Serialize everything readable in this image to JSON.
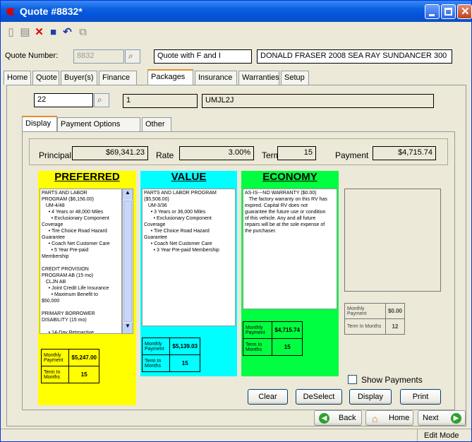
{
  "window": {
    "title": "Quote #8832*"
  },
  "header": {
    "quote_number_label": "Quote Number:",
    "quote_number_value": "8832",
    "quote_desc": "Quote with F and I",
    "unit_desc": "DONALD FRASER 2008 SEA RAY SUNDANCER 300"
  },
  "main_tabs": [
    "Home",
    "Quote",
    "Buyer(s)",
    "Finance",
    "Packages",
    "Insurance",
    "Warranties",
    "Setup"
  ],
  "packages": {
    "code": "22",
    "seq": "1",
    "plan_code": "UMJL2J"
  },
  "sub_tabs": [
    "Display",
    "Payment Options",
    "Other"
  ],
  "terms": {
    "principal_label": "Principal",
    "principal": "$69,341.23",
    "rate_label": "Rate",
    "rate": "3.00%",
    "term_label": "Term",
    "term": "15",
    "payment_label": "Payment",
    "payment": "$4,715.74"
  },
  "columns": [
    {
      "title": "PREFERRED",
      "color": "#ffff00",
      "lines": [
        "PARTS AND LABOR",
        "PROGRAM ($6,156.00)",
        "   UM-4/48",
        "     • 4 Years or 48,000 Miles",
        "       • Exclusionary Component",
        "Coverage",
        "     • Tire Choice Road Hazard",
        "Guarantee",
        "     • Coach Net Customer Care",
        "       • 5 Year Pre-paid",
        "Membership",
        "",
        "CREDIT PROVISION",
        "PROGRAM AB (15 mo)",
        "   CLJN AB",
        "     • Joint Credit Life Insurance",
        "       • Maximum Benefit to",
        "$50,000",
        "",
        "PRIMARY BORROWER",
        "DISABILITY (15 mo)",
        "",
        "     • 14-Day Retroactive"
      ],
      "monthly_label": "Monthly Payment",
      "monthly": "$5,247.00",
      "term_label": "Term In Months",
      "term": "15"
    },
    {
      "title": "VALUE",
      "color": "#00ffff",
      "lines": [
        "PARTS AND LABOR PROGRAM",
        "($5,508.00)",
        "   UM-3/36",
        "     • 3 Years or 36,000 Miles",
        "       • Exclusionary Component",
        "Coverage",
        "     • Tire Choice Road Hazard",
        "Guarantee",
        "     • Coach Net Customer Care",
        "       • 3 Year Pre-paid Membership"
      ],
      "monthly_label": "Monthly Payment",
      "monthly": "$5,139.03",
      "term_label": "Term In Months",
      "term": "15"
    },
    {
      "title": "ECONOMY",
      "color": "#00ff40",
      "lines": [
        "AS-IS---NO WARRANTY ($0.00)",
        "   The factory warranty on this RV has",
        "expired. Capital RV does not",
        "guarantee the future use or condition",
        "of this vehicle. Any and all future",
        "repairs will be at the sole expense of",
        "the purchaser."
      ],
      "monthly_label": "Monthly Payment",
      "monthly": "$4,715.74",
      "term_label": "Term In Months",
      "term": "15"
    },
    {
      "title": "",
      "color": "#ece9d8",
      "lines": [],
      "monthly_label": "Monthly Payment",
      "monthly": "$0.00",
      "term_label": "Term In Months",
      "term": "12"
    }
  ],
  "show_payments_label": "Show Payments",
  "buttons": {
    "clear": "Clear",
    "deselect": "DeSelect",
    "display": "Display",
    "print": "Print",
    "back": "Back",
    "home": "Home",
    "next": "Next"
  },
  "status": {
    "mode": "Edit Mode"
  }
}
